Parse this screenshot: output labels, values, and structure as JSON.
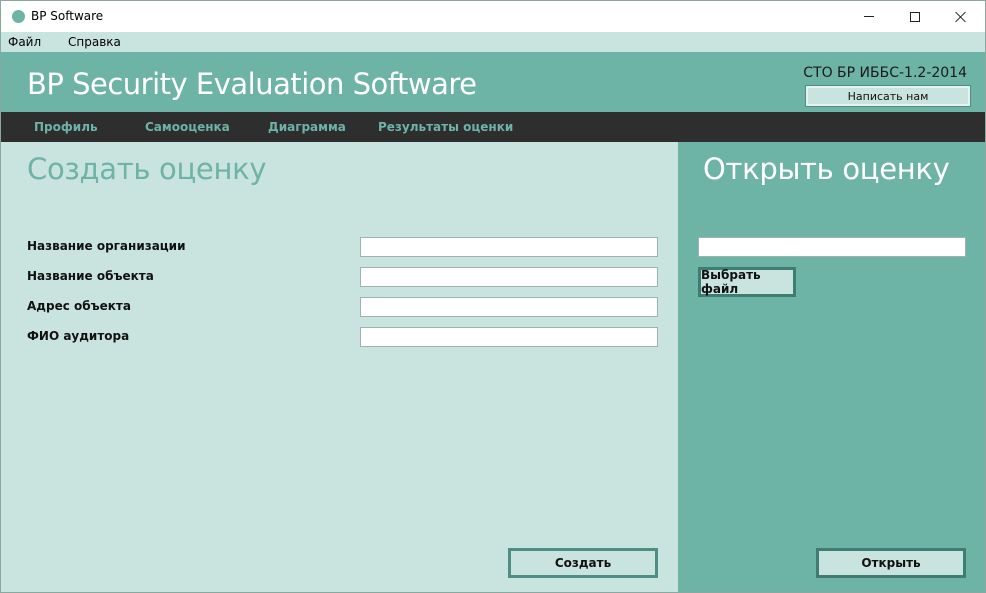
{
  "window": {
    "title": "BP Software",
    "controls": {
      "minimize_icon": "minimize-icon",
      "maximize_icon": "maximize-icon",
      "close_icon": "close-icon"
    }
  },
  "menu": {
    "items": [
      {
        "label": "Файл"
      },
      {
        "label": "Справка"
      }
    ]
  },
  "header": {
    "title": "BP Security Evaluation Software",
    "standard": "СТО БР ИББС-1.2-2014",
    "contact_label": "Написать нам"
  },
  "nav": {
    "items": [
      {
        "label": "Профиль"
      },
      {
        "label": "Самооценка"
      },
      {
        "label": "Диаграмма"
      },
      {
        "label": "Результаты оценки"
      }
    ]
  },
  "create": {
    "title": "Создать оценку",
    "fields": [
      {
        "label": "Название организации",
        "value": ""
      },
      {
        "label": "Название объекта",
        "value": ""
      },
      {
        "label": "Адрес объекта",
        "value": ""
      },
      {
        "label": "ФИО аудитора",
        "value": ""
      }
    ],
    "submit_label": "Создать"
  },
  "open": {
    "title": "Открыть оценку",
    "file_value": "",
    "choose_label": "Выбрать файл",
    "submit_label": "Открыть"
  },
  "colors": {
    "accent": "#6db3a6",
    "light": "#c9e4df",
    "nav_bg": "#2e2e2e"
  }
}
